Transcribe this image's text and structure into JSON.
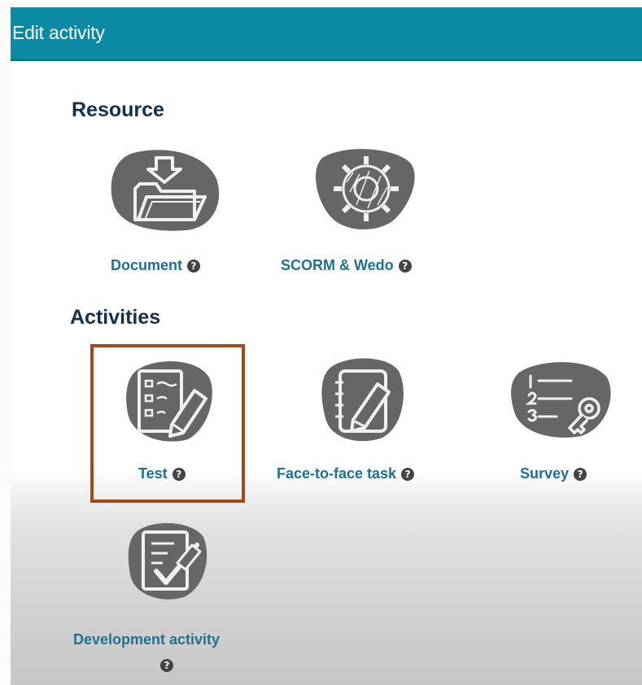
{
  "window": {
    "title": "Edit activity"
  },
  "sections": {
    "resource": {
      "title": "Resource"
    },
    "activities": {
      "title": "Activities"
    }
  },
  "tiles": {
    "document": {
      "label": "Document",
      "icon": "folder-download-icon",
      "help": "?"
    },
    "scorm": {
      "label": "SCORM & Wedo",
      "icon": "gear-icon",
      "help": "?"
    },
    "test": {
      "label": "Test",
      "icon": "checklist-pencil-icon",
      "help": "?",
      "selected": true
    },
    "face_to_face": {
      "label": "Face-to-face task",
      "icon": "notebook-pencil-icon",
      "help": "?"
    },
    "survey": {
      "label": "Survey",
      "icon": "numbered-list-key-icon",
      "help": "?"
    },
    "development": {
      "label": "Development activity",
      "icon": "document-check-icon",
      "help": "?"
    }
  },
  "colors": {
    "header": "#0d8aa3",
    "section_title": "#14304a",
    "tile_label": "#1e7190",
    "selection_border": "#a14a1c",
    "icon_blob": "#666666"
  }
}
